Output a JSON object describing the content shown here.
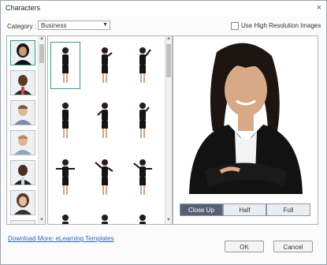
{
  "window": {
    "title": "Characters",
    "close_glyph": "×"
  },
  "category": {
    "label": "Category :",
    "selected": "Business",
    "arrow": "▼"
  },
  "hires": {
    "label": "Use High Resolution Images",
    "checked": false
  },
  "views": {
    "close_up": "Close Up",
    "half": "Half",
    "full": "Full",
    "active": "Close Up"
  },
  "footer": {
    "link": "Download More: eLearning Templates",
    "ok": "OK",
    "cancel": "Cancel"
  },
  "colors": {
    "accent": "#3a9a87",
    "active_tab": "#566273",
    "link": "#2b66b8"
  }
}
